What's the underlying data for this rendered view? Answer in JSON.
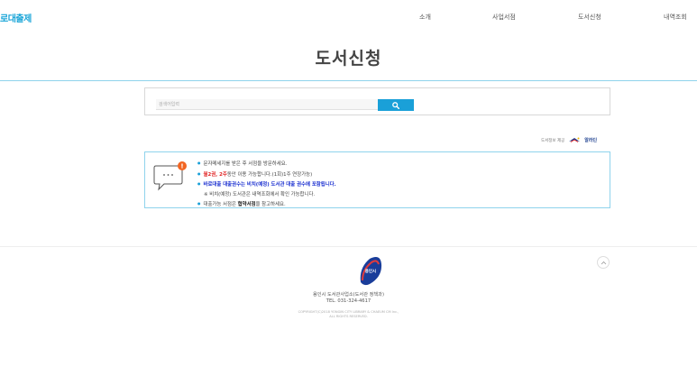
{
  "header": {
    "logo_text": "로대출제",
    "nav": [
      "소개",
      "사업서점",
      "도서신청",
      "내역조회"
    ]
  },
  "page": {
    "title": "도서신청"
  },
  "search": {
    "placeholder": "검색어입력",
    "button_icon": "search-icon"
  },
  "provider": {
    "label": "도서정보 제공",
    "brand": "알라딘"
  },
  "notice": {
    "icon": "chat-bubble-icon",
    "badge": "!",
    "line1": "문자메세지를 받은 후 서점을 방문하세요.",
    "line2_red": "월2권, 2주",
    "line2_rest": "동안 이용 가능합니다.(1회)1주 연장가능)",
    "line3": "바로대출 대출권수는 비치(예정) 도서관 대출 권수에 포함됩니다.",
    "line4": "※ 비치(예정) 도서관은 내역조회에서 확인 가능합니다.",
    "line5_pre": "대출가능 서점은 ",
    "line5_strong": "협약서점",
    "line5_post": "을 참고하세요."
  },
  "footer": {
    "logo_text": "용인시",
    "org": "용인시 도서관사업소(도서관 정책과)",
    "tel": "TEL. 031-324-4617",
    "copyright1": "COPYRIGHT(C)2018 YONGIN CITY LIBRARY & CHAEUM CM Inc.,",
    "copyright2": "ALL RIGHTS RESERVED.",
    "top_icon": "chevron-up-icon"
  },
  "colors": {
    "accent": "#1aa0d8",
    "border": "#8fd3ec",
    "red": "#e02020",
    "blue": "#1a2fd0",
    "badge": "#f26522"
  }
}
